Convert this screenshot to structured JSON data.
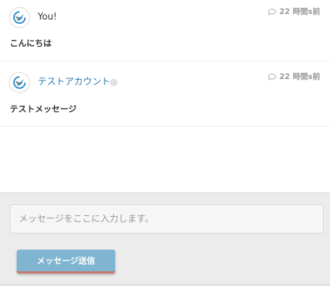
{
  "messages": [
    {
      "sender": "You!",
      "time": "22 時間s前",
      "text": "こんにちは",
      "avatar_icon": "bird-logo-icon"
    },
    {
      "sender": "テストアカウント",
      "time": "22 時間s前",
      "text": "テストメッセージ",
      "avatar_icon": "bird-logo-icon"
    }
  ],
  "composer": {
    "placeholder": "メッセージをここに入力します。",
    "value": "",
    "send_label": "メッセージ送信"
  },
  "colors": {
    "link_name": "#2a7ab0",
    "send_button": "#7fb5d0",
    "send_button_border": "#c97a6d",
    "timestamp": "#999999"
  }
}
